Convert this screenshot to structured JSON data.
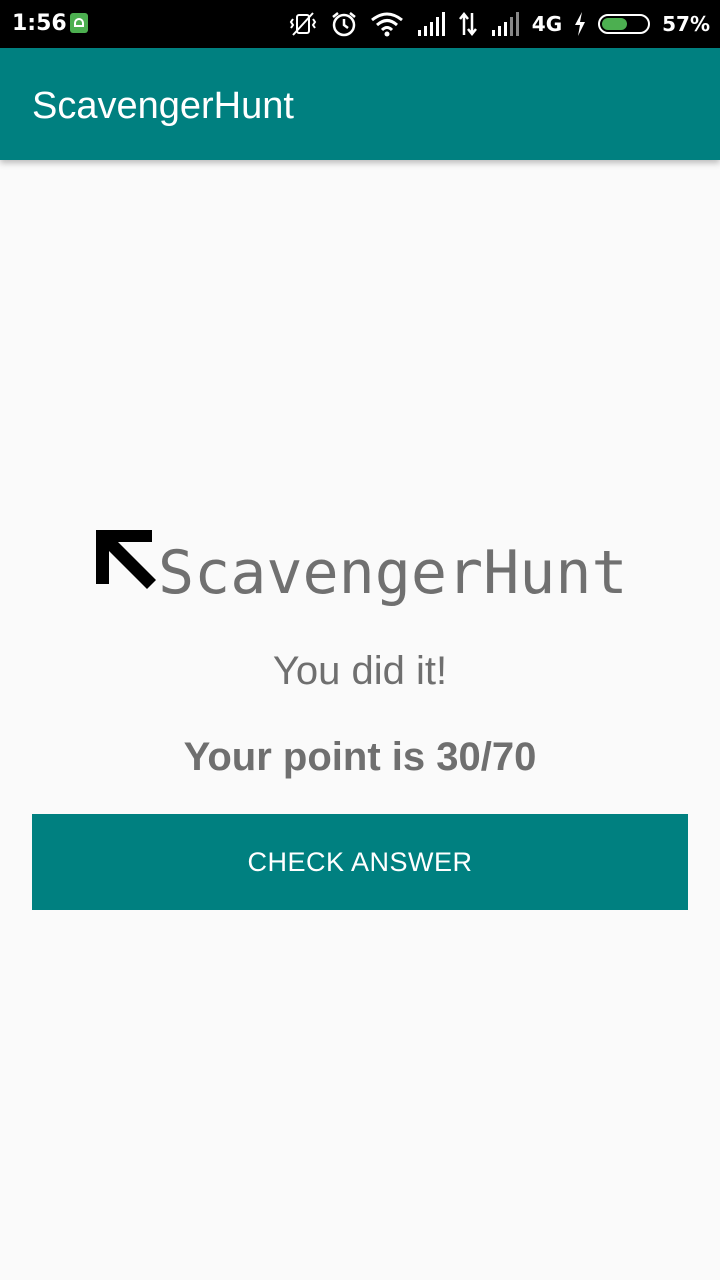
{
  "status_bar": {
    "time": "1:56",
    "network": "4G",
    "battery_percent_text": "57%",
    "battery_level": 0.57,
    "icons": [
      "android-notification-icon",
      "vibrate-off-icon",
      "alarm-icon",
      "wifi-icon",
      "signal-icon",
      "data-transfer-icon",
      "signal-icon",
      "charging-icon",
      "battery-icon"
    ]
  },
  "app_bar": {
    "title": "ScavengerHunt"
  },
  "main": {
    "logo_text": "ScavengerHunt",
    "message": "You did it!",
    "score_text": "Your point is 30/70",
    "check_answer_label": "CHECK ANSWER"
  },
  "colors": {
    "primary": "#008080",
    "background": "#fafafa",
    "text_gray": "#6f6f6f"
  }
}
